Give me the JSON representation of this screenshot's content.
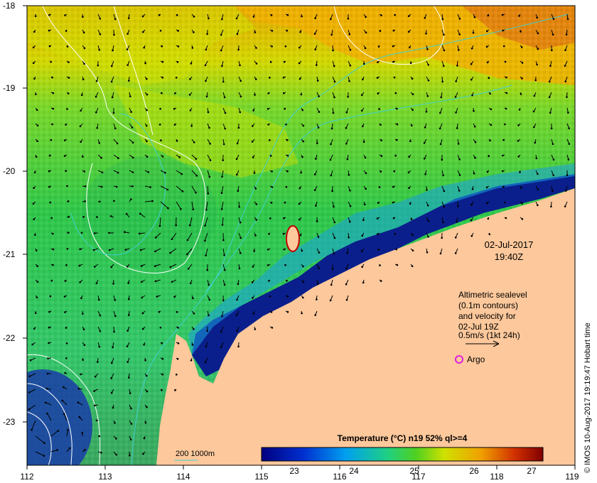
{
  "map": {
    "lon_ticks": [
      "112",
      "113",
      "114",
      "115",
      "116",
      "117",
      "118",
      "119"
    ],
    "lat_ticks": [
      "-18",
      "-19",
      "-20",
      "-21",
      "-22",
      "-23"
    ],
    "date_line1": "02-Jul-2017",
    "date_line2": "19:40Z",
    "legend_lines": [
      "Altimetric sealevel",
      "(0.1m contours)",
      "and velocity for",
      "02-Jul 19Z",
      "0.5m/s (1kt 24h)"
    ],
    "argo_label": "Argo",
    "bathy_label": "200  1000m",
    "colorbar_title": "Temperature (°C) n19 52% ql>=4",
    "colorbar_ticks": [
      "23",
      "24",
      "25",
      "26",
      "27"
    ],
    "credit": "© IMOS 10-Aug-2017 19:19:47 Hobart time",
    "colors": {
      "land": "#fdc89b",
      "warm": "#f0b400",
      "mid": "#3dcc3a",
      "cool": "#0a1f8c",
      "contour": "#ffffff",
      "bathy": "#40d0d0",
      "argo": "#e020e0"
    }
  }
}
